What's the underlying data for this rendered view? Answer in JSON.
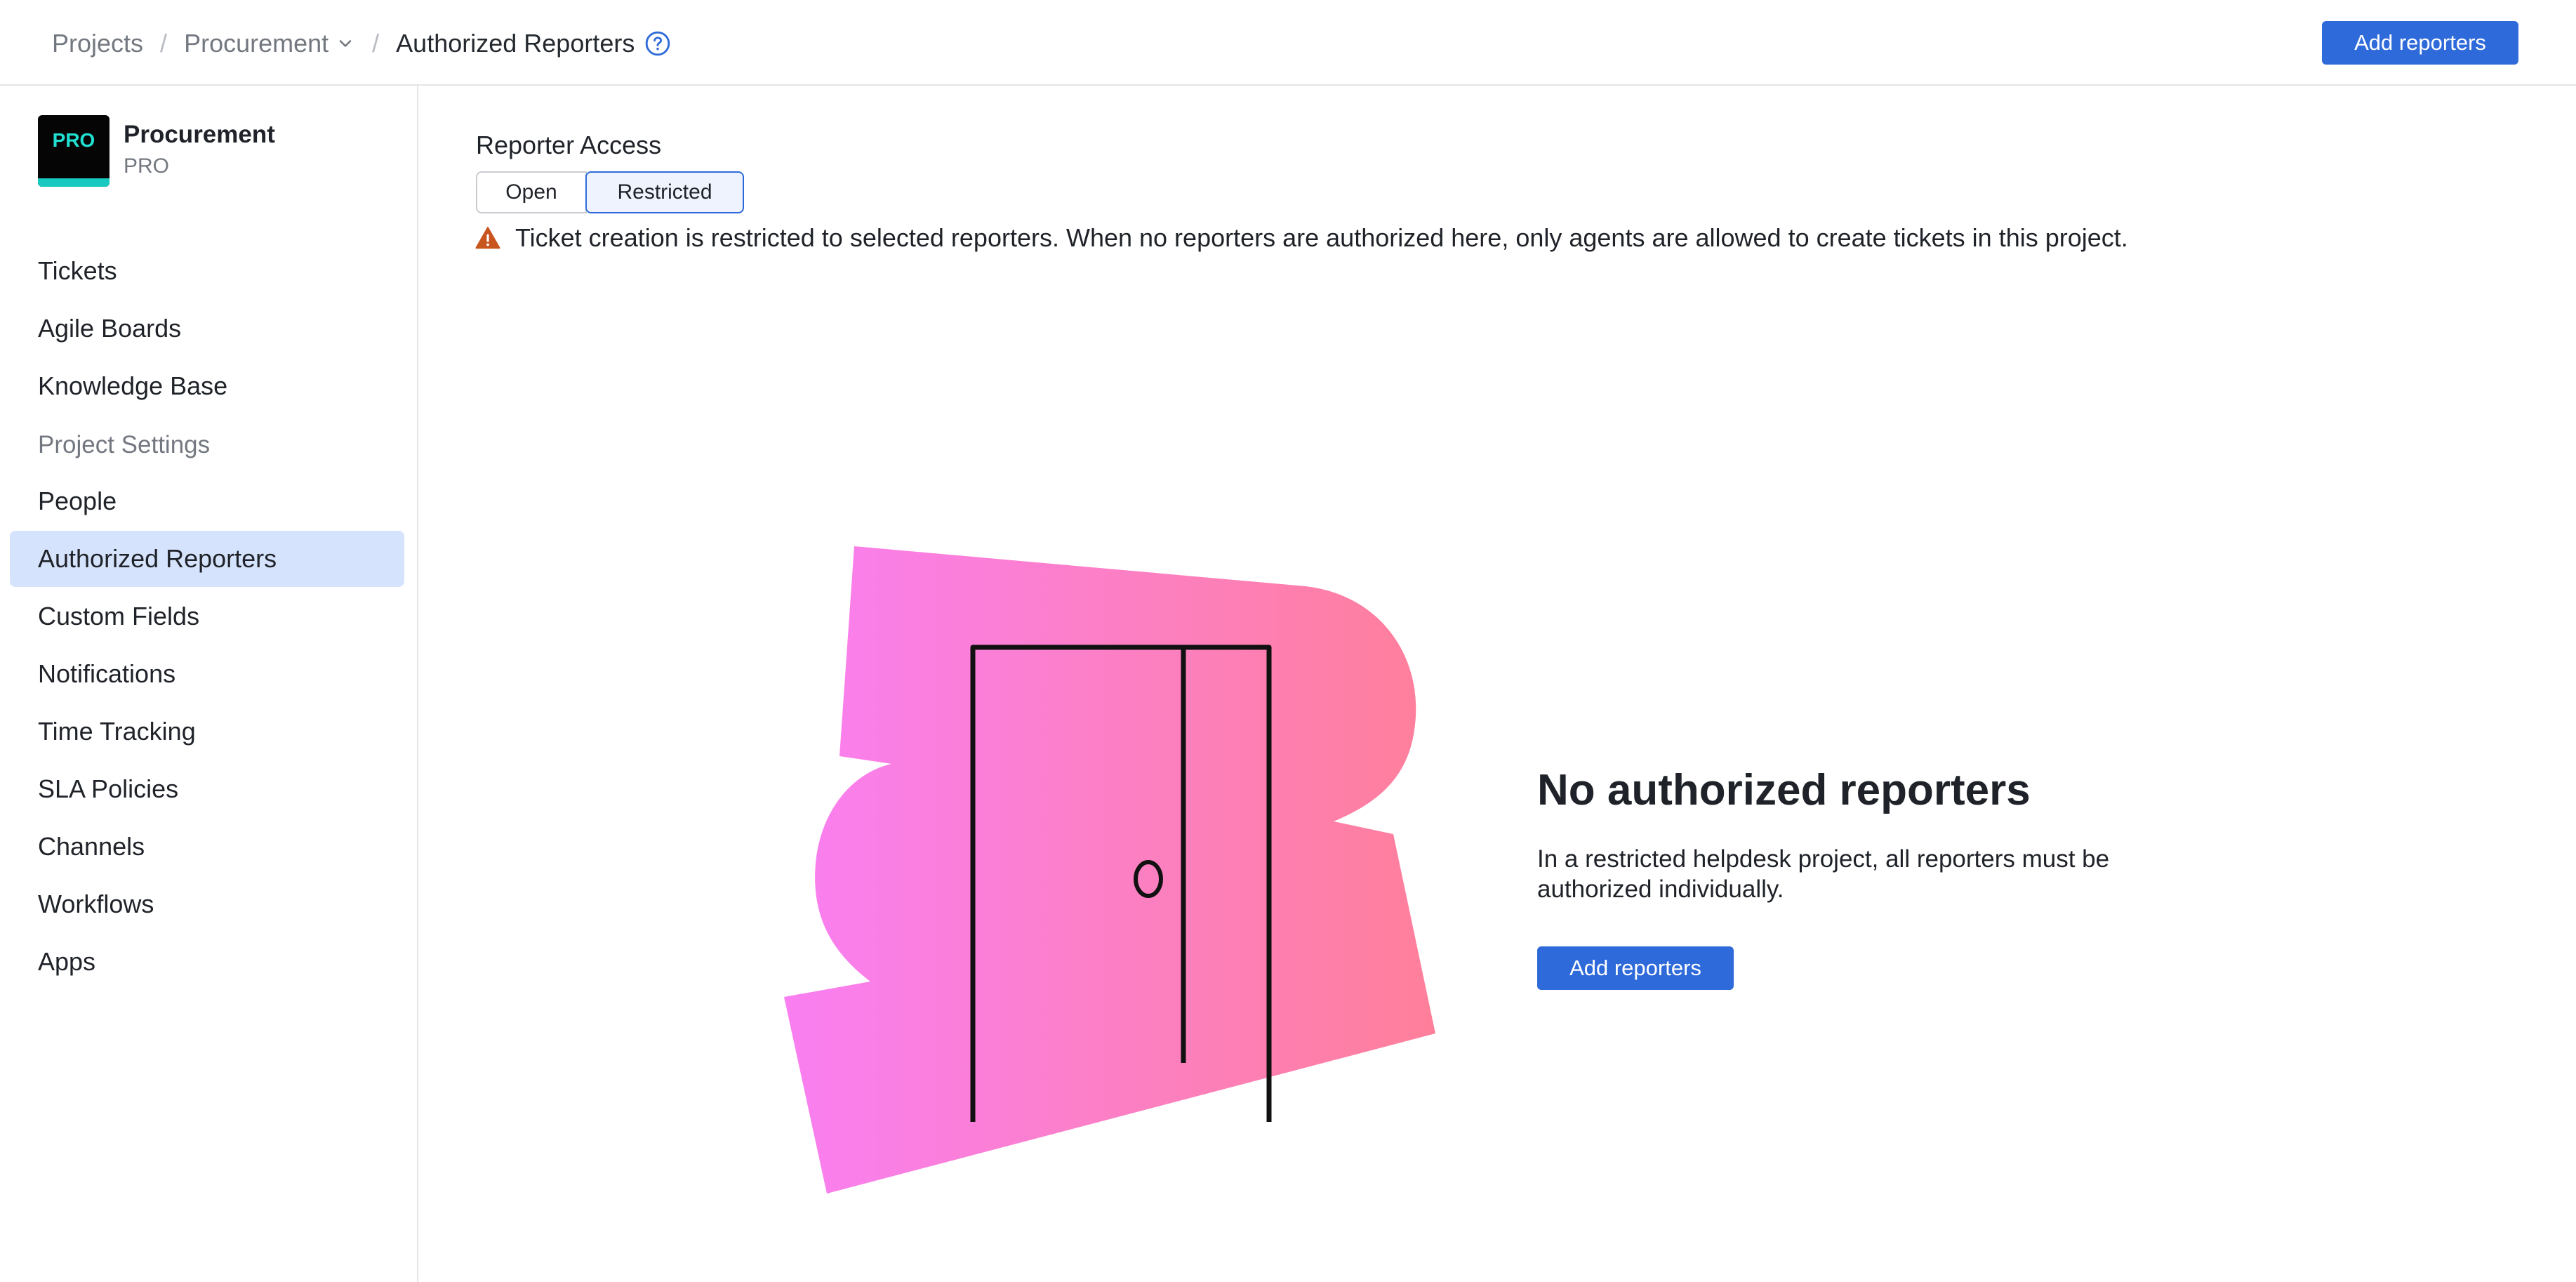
{
  "breadcrumb": {
    "items": [
      "Projects",
      "Procurement"
    ],
    "current": "Authorized Reporters"
  },
  "header": {
    "add_button": "Add reporters"
  },
  "sidebar": {
    "project": {
      "logo_text": "PRO",
      "name": "Procurement",
      "key": "PRO"
    },
    "items": [
      "Tickets",
      "Agile Boards",
      "Knowledge Base"
    ],
    "section_label": "Project Settings",
    "settings_items": [
      "People",
      "Authorized Reporters",
      "Custom Fields",
      "Notifications",
      "Time Tracking",
      "SLA Policies",
      "Channels",
      "Workflows",
      "Apps"
    ],
    "active_item": "Authorized Reporters"
  },
  "main": {
    "access_label": "Reporter Access",
    "options": [
      "Open",
      "Restricted"
    ],
    "selected_option": "Restricted",
    "warning": "Ticket creation is restricted to selected reporters. When no reporters are authorized here, only agents are allowed to create tickets in this project.",
    "empty_state": {
      "title": "No authorized reporters",
      "description": "In a restricted helpdesk project, all reporters must be authorized individually.",
      "button": "Add reporters"
    }
  },
  "colors": {
    "accent": "#2e6ad9",
    "active_nav_bg": "#d6e3fc",
    "warning": "#c8541e",
    "illustration_start": "#f97ff2",
    "illustration_end": "#ff7f9a"
  },
  "icons": {
    "breadcrumb_dropdown": "chevron-down-icon",
    "help": "help-circle-icon",
    "warning": "warning-triangle-icon",
    "illustration": "door-illustration"
  }
}
